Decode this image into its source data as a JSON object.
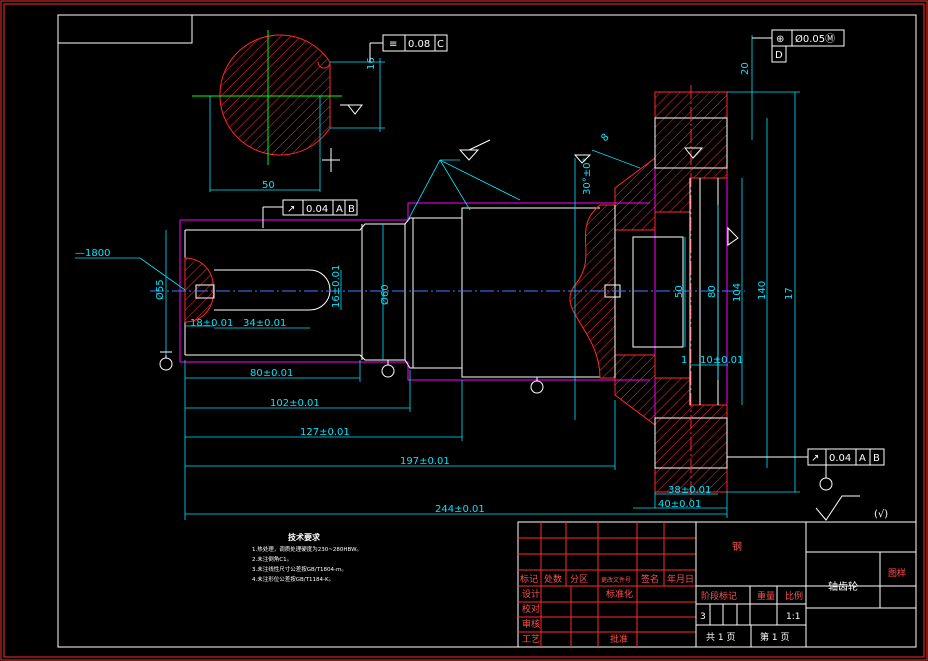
{
  "drawing": {
    "dims": {
      "flatness": "0.08",
      "flatness_datum": "C",
      "key_width": "16",
      "circle_dia": "50",
      "position_tol": "Ø0.05Ⓜ",
      "position_datum": "D",
      "dim_20": "20",
      "chamfer_8": "8",
      "angle": "30°±0°",
      "runout_top": "0.04",
      "runout_datum_a": "A",
      "runout_datum_b": "B",
      "dia55": "Ø55",
      "dia60": "Ø60",
      "d50": "50",
      "d80": "80",
      "d104": "104",
      "d140": "140",
      "d17": "17",
      "d16": "16±0.01",
      "d34": "34±0.01",
      "d18": "18±0.01",
      "d1": "1",
      "d10": "10±0.01",
      "d80h": "80±0.01",
      "d102": "102±0.01",
      "d127": "127±0.01",
      "d197": "197±0.01",
      "d244": "244±0.01",
      "d38": "38±0.01",
      "d40": "40±0.01",
      "runout_bottom": "0.04",
      "leader_note": "—1800",
      "surface_mark": "(√)"
    },
    "notes": {
      "title": "技术要求",
      "lines": [
        "1.热处理，调质处理硬度为230~280HBW。",
        "2.未注倒角C1。",
        "3.未注线性尺寸公差按GB/T1804-m。",
        "4.未注形位公差按GB/T1184-K。"
      ]
    },
    "title_block": {
      "material": "钢",
      "part_name": "轴齿轮",
      "code_label": "图样",
      "row_labels": [
        "标记",
        "处数",
        "分区",
        "更改文件号",
        "签名",
        "年月日"
      ],
      "left_labels": [
        "设计",
        "校对",
        "审核",
        "工艺"
      ],
      "std_label": "标准化",
      "approve_label": "批准",
      "stage_headers": [
        "阶段标记",
        "重量",
        "比例"
      ],
      "stage_value": "3",
      "scale": "1:1",
      "sheets_total": "共 1 页",
      "sheet_no": "第 1 页"
    }
  }
}
